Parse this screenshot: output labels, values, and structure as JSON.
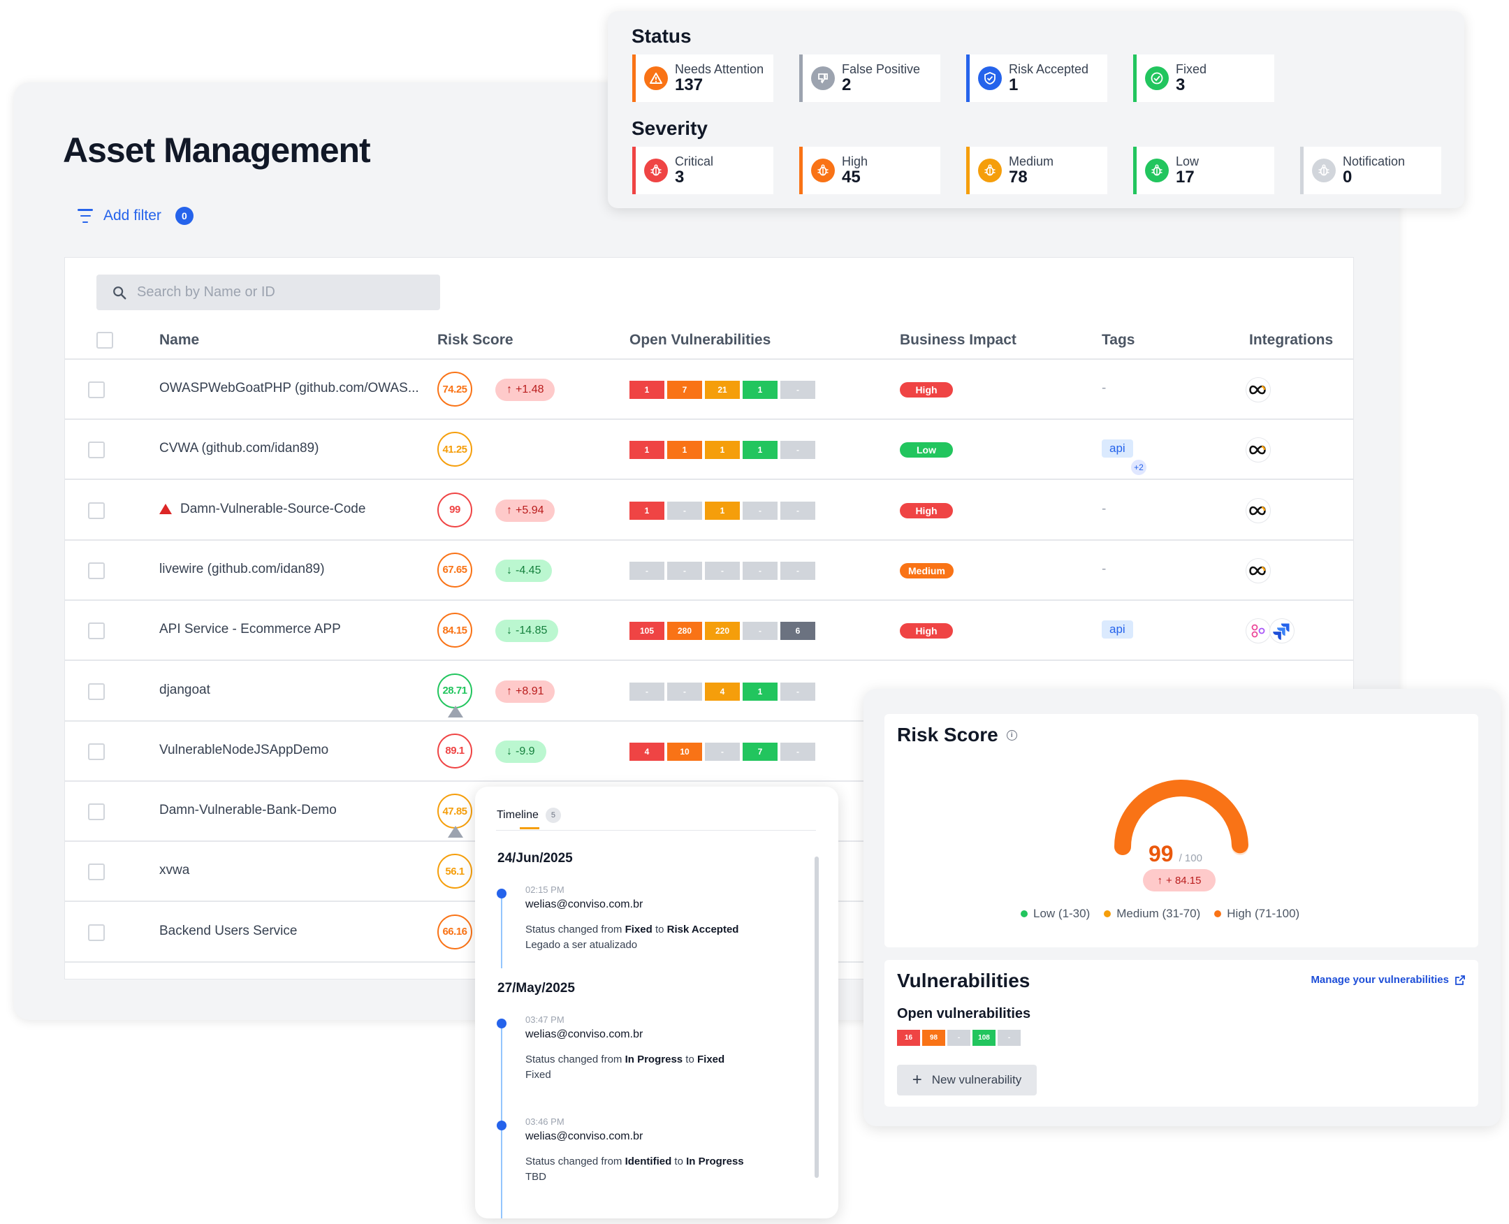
{
  "page": {
    "title": "Asset Management",
    "add_filter_label": "Add filter",
    "filter_count": "0"
  },
  "search": {
    "placeholder": "Search by Name or ID"
  },
  "table": {
    "columns": {
      "name": "Name",
      "risk_score": "Risk Score",
      "open_vulns": "Open Vulnerabilities",
      "business_impact": "Business Impact",
      "tags": "Tags",
      "integrations": "Integrations"
    },
    "rows": [
      {
        "name": "OWASPWebGoatPHP (github.com/OWAS...",
        "warning": false,
        "score": "74.25",
        "score_color": "#f97316",
        "trend": "+1.48",
        "trend_dir": "up",
        "vulns": [
          "1",
          "7",
          "21",
          "1",
          "-"
        ],
        "impact": "High",
        "tag": "-",
        "tag_more": "",
        "integrations": [
          "conviso"
        ],
        "score_triangle": false
      },
      {
        "name": "CVWA (github.com/idan89)",
        "warning": false,
        "score": "41.25",
        "score_color": "#f59e0b",
        "trend": "",
        "trend_dir": "",
        "vulns": [
          "1",
          "1",
          "1",
          "1",
          "-"
        ],
        "impact": "Low",
        "tag": "api",
        "tag_more": "+2",
        "integrations": [
          "conviso"
        ],
        "score_triangle": false
      },
      {
        "name": "Damn-Vulnerable-Source-Code",
        "warning": true,
        "score": "99",
        "score_color": "#ef4444",
        "trend": "+5.94",
        "trend_dir": "up",
        "vulns": [
          "1",
          "-",
          "1",
          "-",
          "-"
        ],
        "impact": "High",
        "tag": "-",
        "tag_more": "",
        "integrations": [
          "conviso"
        ],
        "score_triangle": false
      },
      {
        "name": "livewire (github.com/idan89)",
        "warning": false,
        "score": "67.65",
        "score_color": "#f97316",
        "trend": "-4.45",
        "trend_dir": "down",
        "vulns": [
          "-",
          "-",
          "-",
          "-",
          "-"
        ],
        "impact": "Medium",
        "tag": "-",
        "tag_more": "",
        "integrations": [
          "conviso"
        ],
        "score_triangle": false
      },
      {
        "name": "API Service - Ecommerce APP",
        "warning": false,
        "score": "84.15",
        "score_color": "#f97316",
        "trend": "-14.85",
        "trend_dir": "down",
        "vulns": [
          "105",
          "280",
          "220",
          "-",
          "6"
        ],
        "impact": "High",
        "tag": "api",
        "tag_more": "",
        "integrations": [
          "graph",
          "jira"
        ],
        "score_triangle": false
      },
      {
        "name": "djangoat",
        "warning": false,
        "score": "28.71",
        "score_color": "#22c55e",
        "trend": "+8.91",
        "trend_dir": "up",
        "vulns": [
          "-",
          "-",
          "4",
          "1",
          "-"
        ],
        "impact": "",
        "tag": "",
        "tag_more": "",
        "integrations": [],
        "score_triangle": true
      },
      {
        "name": "VulnerableNodeJSAppDemo",
        "warning": false,
        "score": "89.1",
        "score_color": "#ef4444",
        "trend": "-9.9",
        "trend_dir": "down",
        "vulns": [
          "4",
          "10",
          "-",
          "7",
          "-"
        ],
        "impact": "",
        "tag": "",
        "tag_more": "",
        "integrations": [],
        "score_triangle": false
      },
      {
        "name": "Damn-Vulnerable-Bank-Demo",
        "warning": false,
        "score": "47.85",
        "score_color": "#f59e0b",
        "trend": "",
        "trend_dir": "",
        "vulns": [],
        "impact": "",
        "tag": "",
        "tag_more": "",
        "integrations": [],
        "score_triangle": true
      },
      {
        "name": "xvwa",
        "warning": false,
        "score": "56.1",
        "score_color": "#f59e0b",
        "trend": "",
        "trend_dir": "",
        "vulns": [],
        "impact": "",
        "tag": "",
        "tag_more": "",
        "integrations": [],
        "score_triangle": false
      },
      {
        "name": "Backend Users Service",
        "warning": false,
        "score": "66.16",
        "score_color": "#f97316",
        "trend": "",
        "trend_dir": "",
        "vulns": [],
        "impact": "",
        "tag": "",
        "tag_more": "",
        "integrations": [],
        "score_triangle": false
      }
    ]
  },
  "colors": {
    "critical": "#ef4444",
    "high": "#f97316",
    "medium": "#f59e0b",
    "low": "#22c55e",
    "notification": "#9ca3af",
    "empty": "#d1d5db",
    "notification_filled": "#6b7280",
    "impact_high": "#ef4444",
    "impact_low": "#22c55e",
    "impact_medium": "#f97316",
    "link": "#2563eb"
  },
  "status": {
    "title": "Status",
    "items": [
      {
        "label": "Needs Attention",
        "value": "137",
        "color": "#f97316",
        "icon": "warning-icon"
      },
      {
        "label": "False Positive",
        "value": "2",
        "color": "#9ca3af",
        "icon": "thumbs-down-icon"
      },
      {
        "label": "Risk Accepted",
        "value": "1",
        "color": "#2563eb",
        "icon": "shield-check-icon"
      },
      {
        "label": "Fixed",
        "value": "3",
        "color": "#22c55e",
        "icon": "check-circle-icon"
      }
    ]
  },
  "severity": {
    "title": "Severity",
    "items": [
      {
        "label": "Critical",
        "value": "3",
        "color": "#ef4444",
        "icon": "bug-icon"
      },
      {
        "label": "High",
        "value": "45",
        "color": "#f97316",
        "icon": "bug-icon"
      },
      {
        "label": "Medium",
        "value": "78",
        "color": "#f59e0b",
        "icon": "bug-icon"
      },
      {
        "label": "Low",
        "value": "17",
        "color": "#22c55e",
        "icon": "bug-icon"
      },
      {
        "label": "Notification",
        "value": "0",
        "color": "#d1d5db",
        "icon": "bug-icon"
      }
    ]
  },
  "risk_score": {
    "title": "Risk Score",
    "value": "99",
    "max": "/ 100",
    "fraction": 0.99,
    "delta": "+ 84.15",
    "legend": [
      {
        "label": "Low (1-30)",
        "color": "#22c55e"
      },
      {
        "label": "Medium (31-70)",
        "color": "#f59e0b"
      },
      {
        "label": "High (71-100)",
        "color": "#f97316"
      }
    ]
  },
  "vulnerabilities": {
    "title": "Vulnerabilities",
    "manage_link": "Manage your vulnerabilities",
    "open_label": "Open vulnerabilities",
    "segments": [
      "16",
      "98",
      "-",
      "108",
      "-"
    ],
    "new_button": "New vulnerability"
  },
  "timeline": {
    "tab_label": "Timeline",
    "count": "5",
    "groups": [
      {
        "date": "24/Jun/2025",
        "entries": [
          {
            "time": "02:15 PM",
            "user": "welias@conviso.com.br",
            "desc_prefix": "Status changed from ",
            "from": "Fixed",
            "mid": " to ",
            "to": "Risk Accepted",
            "note": "Legado a ser atualizado"
          }
        ]
      },
      {
        "date": "27/May/2025",
        "entries": [
          {
            "time": "03:47 PM",
            "user": "welias@conviso.com.br",
            "desc_prefix": "Status changed from ",
            "from": "In Progress",
            "mid": " to ",
            "to": "Fixed",
            "note": "Fixed"
          },
          {
            "time": "03:46 PM",
            "user": "welias@conviso.com.br",
            "desc_prefix": "Status changed from ",
            "from": "Identified",
            "mid": " to ",
            "to": "In Progress",
            "note": "TBD"
          }
        ]
      }
    ]
  }
}
